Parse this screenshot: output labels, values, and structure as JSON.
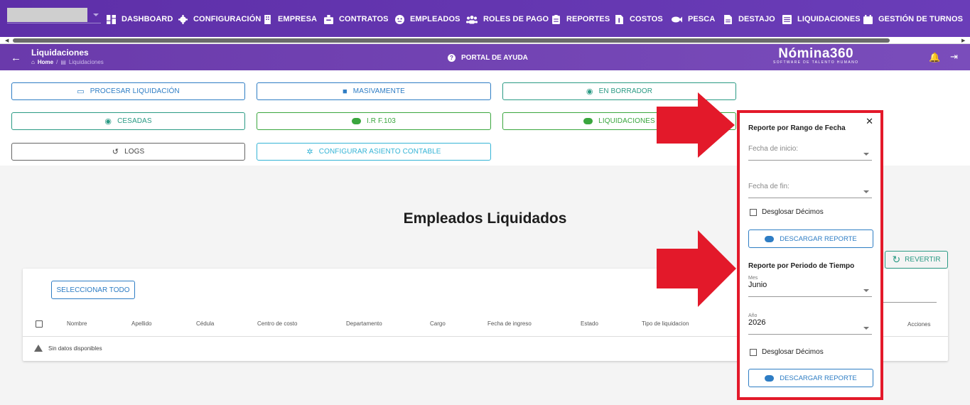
{
  "topnav": {
    "items": [
      {
        "label": "DASHBOARD",
        "icon": "dashboard-icon"
      },
      {
        "label": "CONFIGURACIÓN",
        "icon": "gear-icon"
      },
      {
        "label": "EMPRESA",
        "icon": "building-icon"
      },
      {
        "label": "CONTRATOS",
        "icon": "briefcase-icon"
      },
      {
        "label": "EMPLEADOS",
        "icon": "employee-icon"
      },
      {
        "label": "ROLES DE PAGO",
        "icon": "users-icon"
      },
      {
        "label": "REPORTES",
        "icon": "clipboard-icon"
      },
      {
        "label": "COSTOS",
        "icon": "file-dollar-icon"
      },
      {
        "label": "PESCA",
        "icon": "fish-icon"
      },
      {
        "label": "DESTAJO",
        "icon": "file-icon"
      },
      {
        "label": "LIQUIDACIONES",
        "icon": "list-icon"
      },
      {
        "label": "GESTIÓN DE TURNOS",
        "icon": "calendar-icon"
      }
    ]
  },
  "header": {
    "title": "Liquidaciones",
    "breadcrumb_home": "Home",
    "breadcrumb_current": "Liquidaciones",
    "help_label": "PORTAL DE AYUDA",
    "logo_text": "Nómina360",
    "logo_sub": "SOFTWARE DE TALENTO HUMANO"
  },
  "actions": {
    "procesar": "PROCESAR LIQUIDACIÓN",
    "masivamente": "MASIVAMENTE",
    "borrador": "EN BORRADOR",
    "cesadas": "CESADAS",
    "ir": "I.R F.103",
    "liquidaciones": "LIQUIDACIONES",
    "logs": "LOGS",
    "asiento": "CONFIGURAR ASIENTO CONTABLE"
  },
  "main": {
    "title": "Empleados Liquidados",
    "revert": "REVERTIR",
    "select_all": "SELECCIONAR TODO",
    "columns": [
      "Nombre",
      "Apellido",
      "Cédula",
      "Centro de costo",
      "Departamento",
      "Cargo",
      "Fecha de ingreso",
      "Estado",
      "Tipo de liquidacion",
      "Acciones"
    ],
    "empty": "Sin datos disponibles"
  },
  "popup": {
    "close": "✕",
    "section1_title": "Reporte por Rango de Fecha",
    "start_placeholder": "Fecha de inicio:",
    "end_placeholder": "Fecha de fin:",
    "desglosar1": "Desglosar Décimos",
    "download1": "DESCARGAR REPORTE",
    "section2_title": "Reporte por Periodo de Tiempo",
    "mes_label": "Mes",
    "mes_value": "Junio",
    "anio_label": "Año",
    "anio_value": "2026",
    "desglosar2": "Desglosar Décimos",
    "download2": "DESCARGAR REPORTE"
  },
  "colors": {
    "nav": "#5e2fa8",
    "highlight": "#e3192a",
    "blue": "#2e7dc4",
    "green": "#3aa63e",
    "teal": "#2a9a84"
  }
}
